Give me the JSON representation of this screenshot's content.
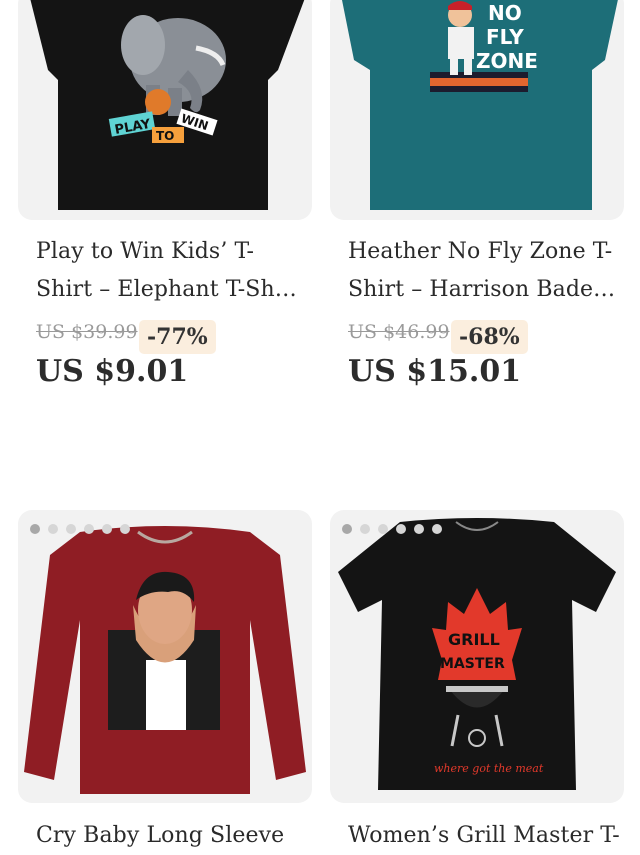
{
  "products": [
    {
      "title_line1": "Play to Win Kids’ T-",
      "title_line2": "Shirt – Elephant T-Sh…",
      "old_price": "US $39.99",
      "discount": "-77%",
      "price": "US $9.01",
      "graphic_text": [
        "PLAY",
        "TO",
        "WIN"
      ]
    },
    {
      "title_line1": "Heather No Fly Zone T-",
      "title_line2": "Shirt – Harrison Bade…",
      "old_price": "US $46.99",
      "discount": "-68%",
      "price": "US $15.01",
      "graphic_text": [
        "NO",
        "FLY",
        "ZONE"
      ]
    },
    {
      "title_line1": "Cry Baby Long Sleeve",
      "carousel_dots": 6,
      "active_dot": 0
    },
    {
      "title_line1": "Women’s Grill Master T-",
      "carousel_dots": 6,
      "active_dot": 0,
      "graphic_text": [
        "GRILL",
        "MASTER",
        "where got the meat"
      ]
    }
  ],
  "colors": {
    "shirt_black": "#141414",
    "shirt_teal": "#1d6e78",
    "shirt_maroon": "#8f1d24",
    "discount_bg": "#fbeede"
  }
}
